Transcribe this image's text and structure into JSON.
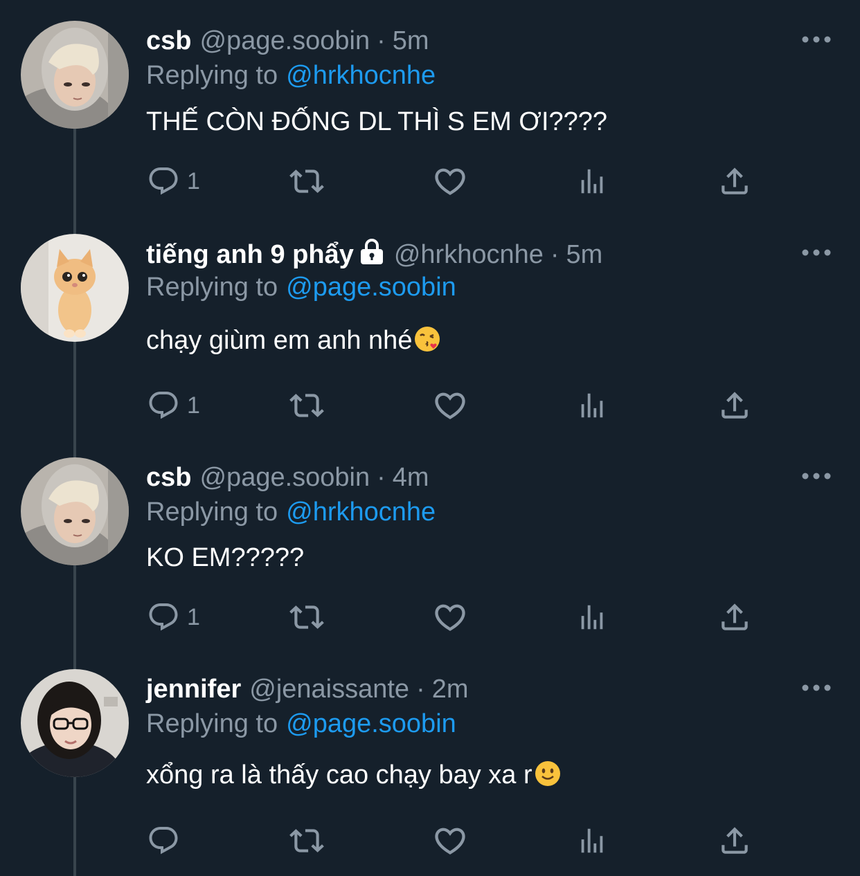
{
  "theme": {
    "background": "#15202b",
    "text": "#ffffff",
    "muted": "#8b98a5",
    "link": "#1d9bf0",
    "thread_line": "#38444d"
  },
  "tweets": [
    {
      "name": "csb",
      "handle": "@page.soobin",
      "dot": "·",
      "time": "5m",
      "reply_prefix": "Replying to",
      "reply_to": "@hrkhocnhe",
      "text": "THẾ CÒN ĐỐNG DL THÌ S EM ƠI????",
      "reply_count": "1",
      "avatar_icon": "avatar-blonde-hoodie",
      "emoji": ""
    },
    {
      "name": "tiếng anh 9 phẩy",
      "handle": "@hrkhocnhe",
      "dot": "·",
      "time": "5m",
      "reply_prefix": "Replying to",
      "reply_to": "@page.soobin",
      "text": "chạy giùm em anh nhé",
      "reply_count": "1",
      "avatar_icon": "avatar-kitten",
      "emoji": "face-blowing-kiss-emoji",
      "locked": "lock-icon"
    },
    {
      "name": "csb",
      "handle": "@page.soobin",
      "dot": "·",
      "time": "4m",
      "reply_prefix": "Replying to",
      "reply_to": "@hrkhocnhe",
      "text": "KO EM?????",
      "reply_count": "1",
      "avatar_icon": "avatar-blonde-hoodie",
      "emoji": ""
    },
    {
      "name": "jennifer",
      "handle": "@jenaissante",
      "dot": "·",
      "time": "2m",
      "reply_prefix": "Replying to",
      "reply_to": "@page.soobin",
      "text": "xổng ra là thấy cao chạy bay xa r",
      "reply_count": "",
      "avatar_icon": "avatar-glasses-girl",
      "emoji": "slightly-smiling-face-emoji"
    }
  ],
  "action_icons": [
    "reply-icon",
    "retweet-icon",
    "like-icon",
    "views-icon",
    "share-icon"
  ],
  "more_icon": "more-options-icon"
}
